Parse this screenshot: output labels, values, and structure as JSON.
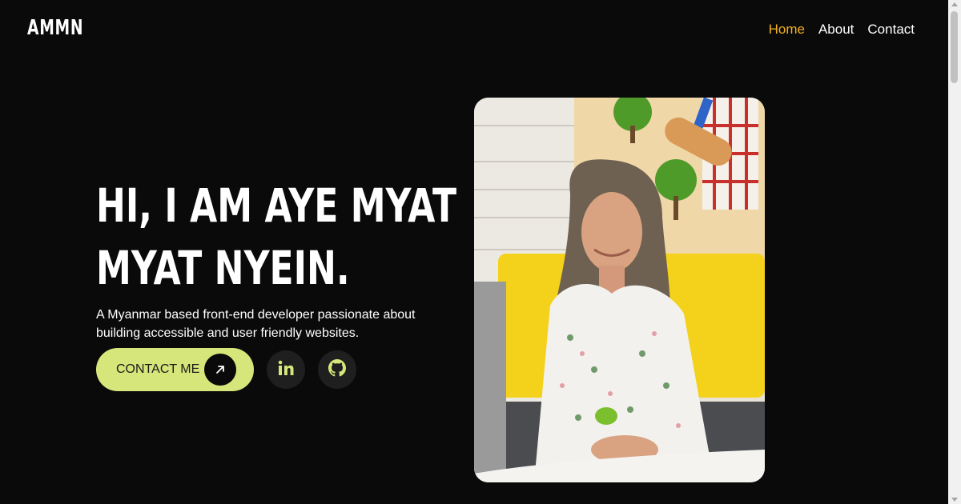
{
  "header": {
    "logo": "AMMN",
    "nav": [
      {
        "label": "Home",
        "active": true
      },
      {
        "label": "About",
        "active": false
      },
      {
        "label": "Contact",
        "active": false
      }
    ]
  },
  "hero": {
    "title_line1": "HI, I AM AYE MYAT",
    "title_line2": "MYAT NYEIN.",
    "description": "A Myanmar based front-end developer passionate about building accessible and user friendly websites.",
    "contact_button": "CONTACT ME",
    "social": [
      {
        "icon": "linkedin-icon"
      },
      {
        "icon": "github-icon"
      }
    ]
  },
  "colors": {
    "background": "#0a0a0a",
    "accent": "#d6e67a",
    "nav_active": "#f2b01e"
  }
}
